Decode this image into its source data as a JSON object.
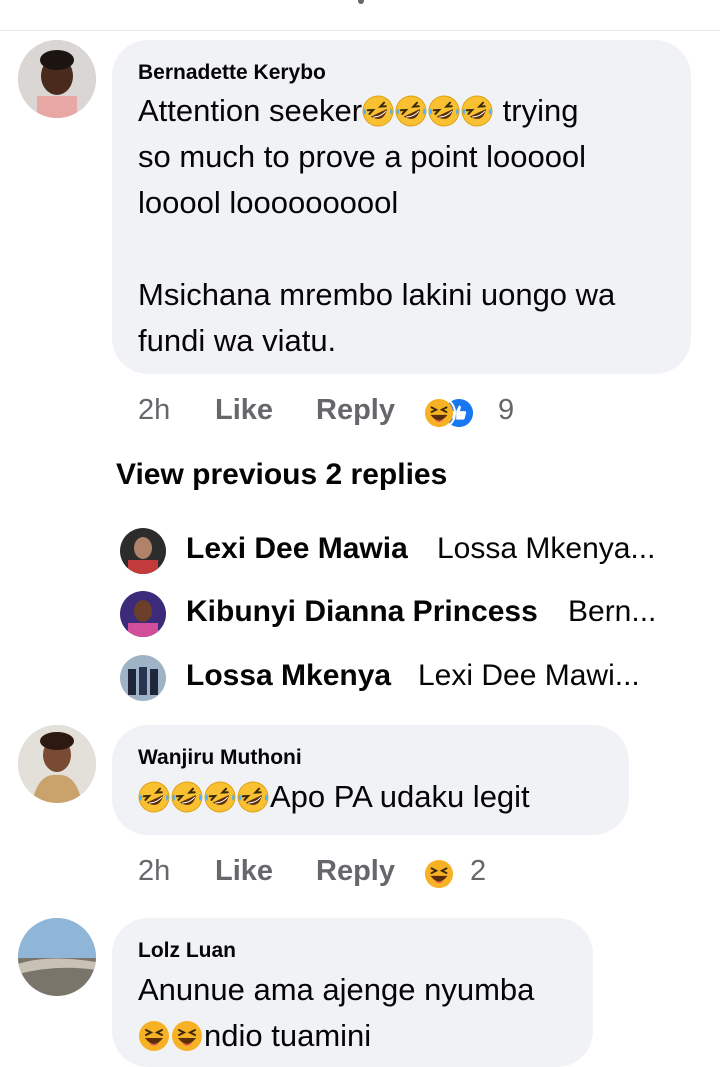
{
  "comments": [
    {
      "author": "Bernadette Kerybo",
      "lines": [
        "Attention seeker",
        "trying",
        "so much to prove a point loooool",
        "looool loooooooool",
        "",
        "Msichana mrembo lakini uongo wa",
        "fundi wa viatu."
      ],
      "time": "2h",
      "like_label": "Like",
      "reply_label": "Reply",
      "reaction_count": "9",
      "reaction_icons": [
        "laughing-face-icon",
        "thumbs-up-icon"
      ]
    },
    {
      "author": "Wanjiru Muthoni",
      "text": "Apo PA udaku legit",
      "time": "2h",
      "like_label": "Like",
      "reply_label": "Reply",
      "reaction_count": "2",
      "reaction_icons": [
        "laughing-face-icon"
      ]
    },
    {
      "author": "Lolz Luan",
      "lines": [
        "Anunue ama ajenge nyumba",
        "ndio tuamini"
      ]
    }
  ],
  "view_previous_label": "View previous 2 replies",
  "replies": [
    {
      "name": "Lexi Dee Mawia",
      "preview": "Lossa Mkenya..."
    },
    {
      "name": "Kibunyi Dianna Princess",
      "preview": "Bern..."
    },
    {
      "name": "Lossa Mkenya",
      "preview": "Lexi Dee Mawi..."
    }
  ],
  "colors": {
    "bubble": "#f0f2f5",
    "meta_text": "#65676b",
    "like_blue": "#1877f2",
    "laugh_yellow": "#f7b125"
  }
}
